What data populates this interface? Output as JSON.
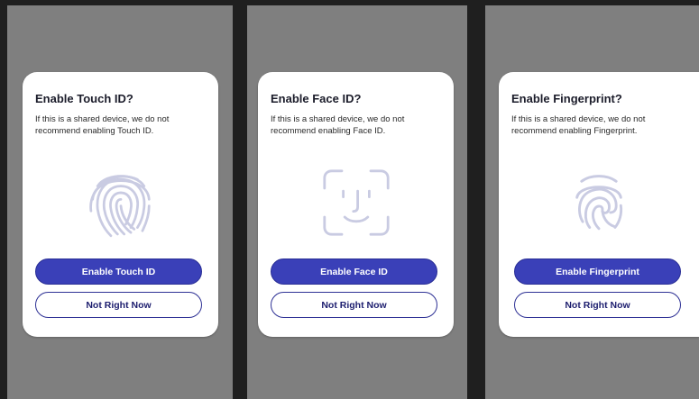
{
  "dialogs": [
    {
      "title": "Enable Touch ID?",
      "message": "If this is a shared device, we do not recommend enabling Touch ID.",
      "icon": "touch-id-fingerprint-icon",
      "primary_button": "Enable Touch ID",
      "secondary_button": "Not Right Now"
    },
    {
      "title": "Enable Face ID?",
      "message": "If this is a shared device, we do not recommend enabling Face ID.",
      "icon": "face-id-icon",
      "primary_button": "Enable Face ID",
      "secondary_button": "Not Right Now"
    },
    {
      "title": "Enable Fingerprint?",
      "message": "If this is a shared device, we do not recommend enabling Fingerprint.",
      "icon": "fingerprint-icon",
      "primary_button": "Enable Fingerprint",
      "secondary_button": "Not Right Now"
    }
  ],
  "colors": {
    "primary_button": "#3a40b8",
    "secondary_border": "#2e3195",
    "icon_stroke": "#c9cbe2",
    "screen_background": "#7f7f7f"
  }
}
